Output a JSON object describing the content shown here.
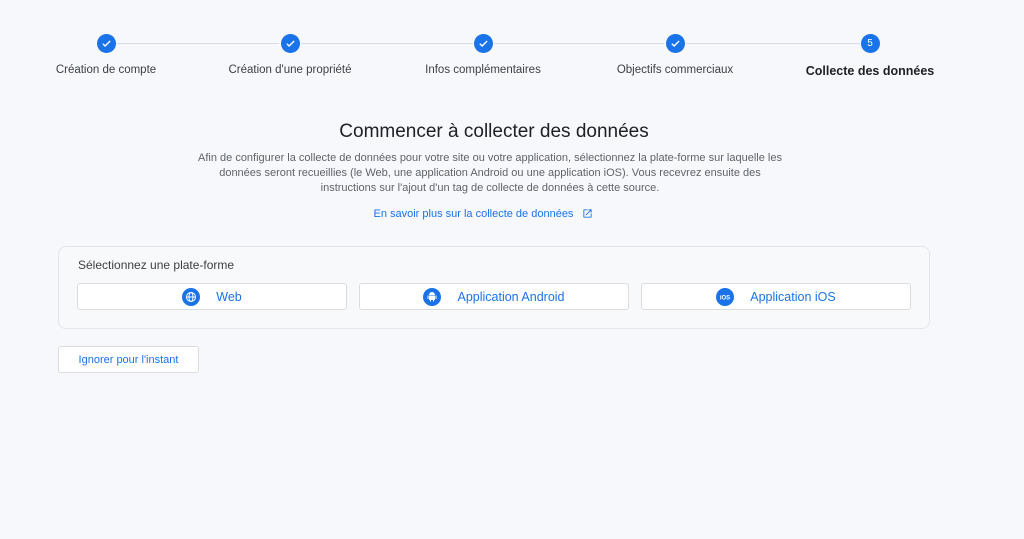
{
  "stepper": {
    "steps": [
      {
        "label": "Création de compte",
        "state": "done",
        "icon": "check-icon"
      },
      {
        "label": "Création d'une propriété",
        "state": "done",
        "icon": "check-icon"
      },
      {
        "label": "Infos complémentaires",
        "state": "done",
        "icon": "check-icon"
      },
      {
        "label": "Objectifs commerciaux",
        "state": "done",
        "icon": "check-icon"
      },
      {
        "label": "Collecte des données",
        "state": "active",
        "number": "5"
      }
    ]
  },
  "main": {
    "title": "Commencer à collecter des données",
    "description": "Afin de configurer la collecte de données pour votre site ou votre application, sélectionnez la plate-forme sur laquelle les données seront recueillies (le Web, une application Android ou une application iOS). Vous recevrez ensuite des instructions sur l'ajout d'un tag de collecte de données à cette source.",
    "learn_more": "En savoir plus sur la collecte de données",
    "learn_more_icon": "open-in-new-icon"
  },
  "platform": {
    "title": "Sélectionnez une plate-forme",
    "options": [
      {
        "label": "Web",
        "icon": "globe-icon"
      },
      {
        "label": "Application Android",
        "icon": "android-icon"
      },
      {
        "label": "Application iOS",
        "icon": "ios-icon"
      }
    ]
  },
  "actions": {
    "skip": "Ignorer pour l'instant"
  },
  "colors": {
    "accent": "#1a73e8",
    "background": "#f7f8fc"
  }
}
